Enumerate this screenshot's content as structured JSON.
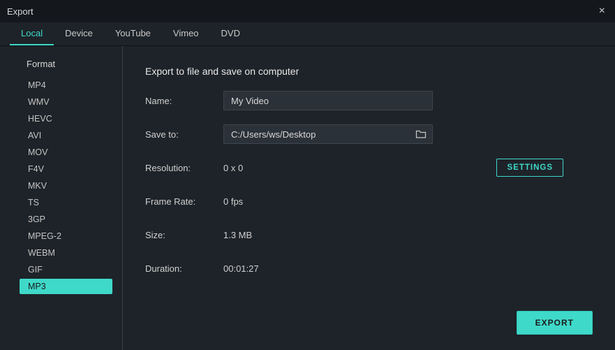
{
  "window_title": "Export",
  "tabs": [
    {
      "label": "Local",
      "active": true
    },
    {
      "label": "Device",
      "active": false
    },
    {
      "label": "YouTube",
      "active": false
    },
    {
      "label": "Vimeo",
      "active": false
    },
    {
      "label": "DVD",
      "active": false
    }
  ],
  "sidebar": {
    "heading": "Format",
    "formats": [
      {
        "label": "MP4",
        "selected": false
      },
      {
        "label": "WMV",
        "selected": false
      },
      {
        "label": "HEVC",
        "selected": false
      },
      {
        "label": "AVI",
        "selected": false
      },
      {
        "label": "MOV",
        "selected": false
      },
      {
        "label": "F4V",
        "selected": false
      },
      {
        "label": "MKV",
        "selected": false
      },
      {
        "label": "TS",
        "selected": false
      },
      {
        "label": "3GP",
        "selected": false
      },
      {
        "label": "MPEG-2",
        "selected": false
      },
      {
        "label": "WEBM",
        "selected": false
      },
      {
        "label": "GIF",
        "selected": false
      },
      {
        "label": "MP3",
        "selected": true
      }
    ]
  },
  "panel": {
    "heading": "Export to file and save on computer",
    "name_label": "Name:",
    "name_value": "My Video",
    "save_to_label": "Save to:",
    "save_to_value": "C:/Users/ws/Desktop",
    "resolution_label": "Resolution:",
    "resolution_value": "0 x 0",
    "settings_button": "SETTINGS",
    "frame_rate_label": "Frame Rate:",
    "frame_rate_value": "0 fps",
    "size_label": "Size:",
    "size_value": "1.3 MB",
    "duration_label": "Duration:",
    "duration_value": "00:01:27",
    "export_button": "EXPORT"
  },
  "colors": {
    "accent": "#3fd9c9",
    "background": "#1e2329",
    "input_bg": "#2b3138"
  }
}
